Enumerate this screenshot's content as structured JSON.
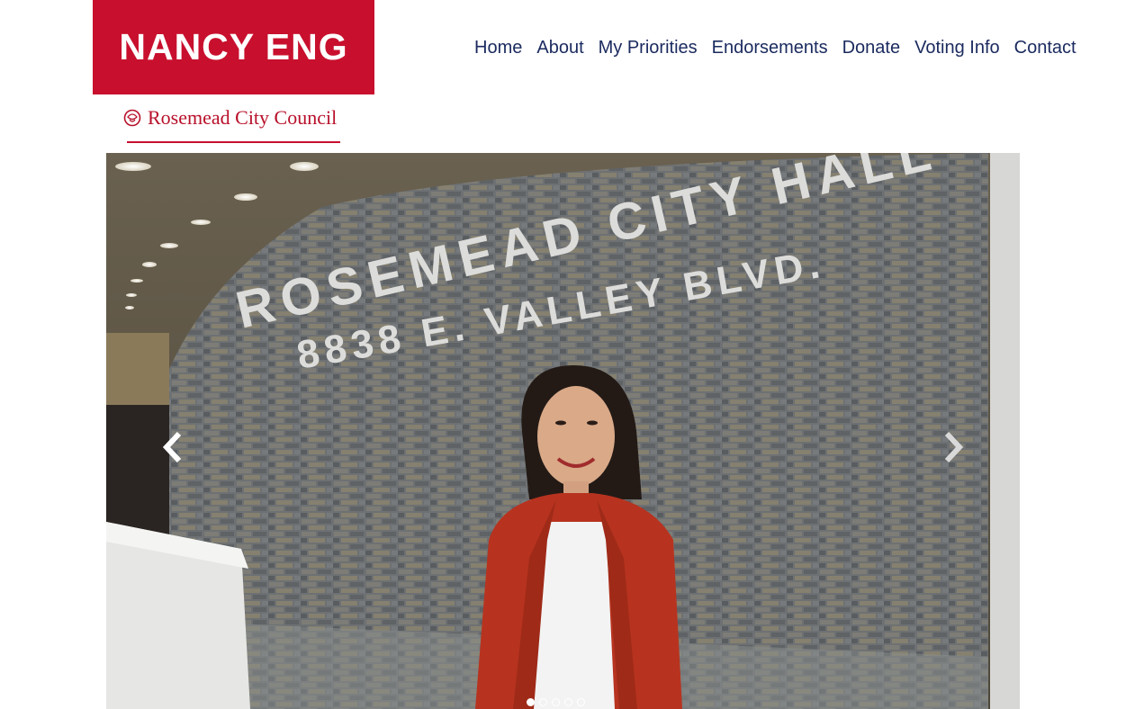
{
  "brand": {
    "logo_text": "NANCY ENG",
    "tagline": "Rosemead City Council",
    "color": "#c8102e"
  },
  "nav": {
    "items": [
      "Home",
      "About",
      "My Priorities",
      "Endorsements",
      "Donate",
      "Voting Info",
      "Contact"
    ],
    "color": "#1a2a5e"
  },
  "hero": {
    "sign_line1": "ROSEMEAD CITY HALL",
    "sign_line2": "8838 E. VALLEY BLVD.",
    "slide_count": 5,
    "active_slide": 1
  }
}
